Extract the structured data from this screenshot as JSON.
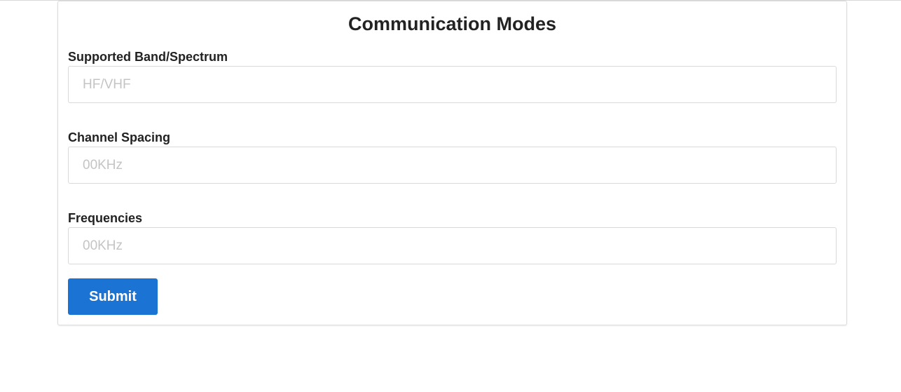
{
  "form": {
    "title": "Communication Modes",
    "fields": [
      {
        "label": "Supported Band/Spectrum",
        "value": "",
        "placeholder": "HF/VHF"
      },
      {
        "label": "Channel Spacing",
        "value": "",
        "placeholder": "00KHz"
      },
      {
        "label": "Frequencies",
        "value": "",
        "placeholder": "00KHz"
      }
    ],
    "submit_label": "Submit"
  },
  "colors": {
    "accent": "#1b74d3",
    "border": "#d9d9d9",
    "placeholder": "#c4c4c4",
    "text": "#222222"
  }
}
